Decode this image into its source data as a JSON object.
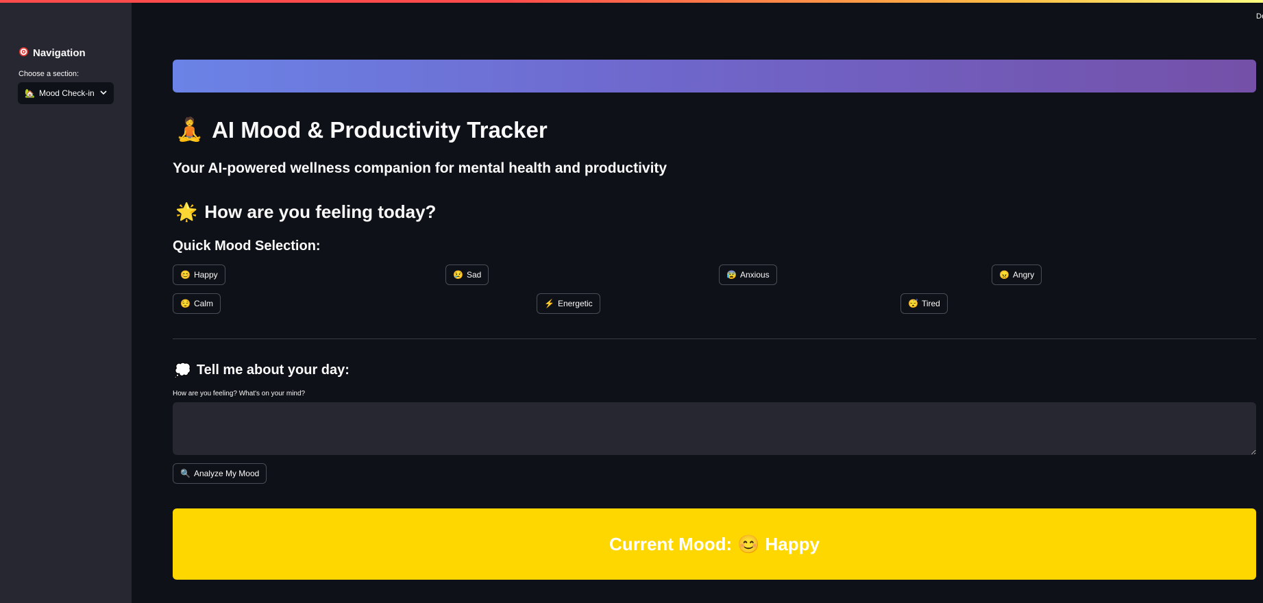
{
  "header": {
    "deploy_label": "Deploy"
  },
  "sidebar": {
    "title_icon": "target-icon",
    "title": "Navigation",
    "select_label": "Choose a section:",
    "select_value_icon": "🏡",
    "select_value": "Mood Check-in"
  },
  "main": {
    "title_icon": "🧘",
    "title": "AI Mood & Productivity Tracker",
    "subtitle": "Your AI-powered wellness companion for mental health and productivity",
    "feeling_icon": "🌟",
    "feeling_heading": "How are you feeling today?",
    "quick_heading": "Quick Mood Selection:",
    "moods_row1": [
      {
        "icon": "😊",
        "label": "Happy"
      },
      {
        "icon": "😢",
        "label": "Sad"
      },
      {
        "icon": "😰",
        "label": "Anxious"
      },
      {
        "icon": "😠",
        "label": "Angry"
      }
    ],
    "moods_row2": [
      {
        "icon": "😌",
        "label": "Calm"
      },
      {
        "icon": "⚡",
        "label": "Energetic"
      },
      {
        "icon": "😴",
        "label": "Tired"
      }
    ],
    "day_icon": "💭",
    "day_heading": "Tell me about your day:",
    "textarea_label": "How are you feeling? What's on your mind?",
    "textarea_value": "",
    "analyze_icon": "🔍",
    "analyze_label": "Analyze My Mood",
    "current_mood_label": "Current Mood:",
    "current_mood_icon": "😊",
    "current_mood_value": "Happy"
  },
  "colors": {
    "background": "#0e1117",
    "sidebar": "#262730",
    "banner_start": "#6b83e6",
    "banner_end": "#7450a8",
    "current_mood_bg": "#ffd700"
  }
}
